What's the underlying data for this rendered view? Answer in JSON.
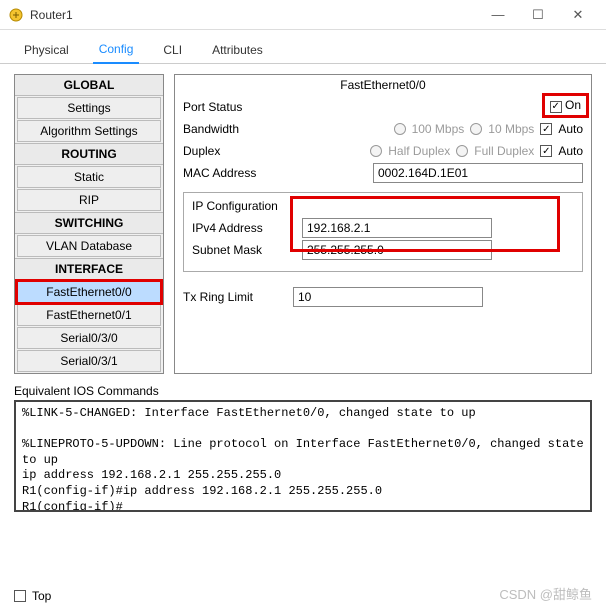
{
  "window": {
    "title": "Router1",
    "min": "—",
    "max": "☐",
    "close": "✕"
  },
  "tabs": {
    "physical": "Physical",
    "config": "Config",
    "cli": "CLI",
    "attributes": "Attributes"
  },
  "sidebar": {
    "global": "GLOBAL",
    "settings": "Settings",
    "algorithm": "Algorithm Settings",
    "routing": "ROUTING",
    "static": "Static",
    "rip": "RIP",
    "switching": "SWITCHING",
    "vlandb": "VLAN Database",
    "interface": "INTERFACE",
    "fe00": "FastEthernet0/0",
    "fe01": "FastEthernet0/1",
    "s030": "Serial0/3/0",
    "s031": "Serial0/3/1"
  },
  "panel": {
    "title": "FastEthernet0/0",
    "port_status": "Port Status",
    "on": "On",
    "bandwidth": "Bandwidth",
    "bw100": "100 Mbps",
    "bw10": "10 Mbps",
    "auto": "Auto",
    "duplex": "Duplex",
    "half": "Half Duplex",
    "full": "Full Duplex",
    "mac_label": "MAC Address",
    "mac_value": "0002.164D.1E01",
    "ipconfig": "IP Configuration",
    "ipv4_label": "IPv4 Address",
    "ipv4_value": "192.168.2.1",
    "subnet_label": "Subnet Mask",
    "subnet_value": "255.255.255.0",
    "tx_label": "Tx Ring Limit",
    "tx_value": "10"
  },
  "cmds": {
    "label": "Equivalent IOS Commands",
    "text": "%LINK-5-CHANGED: Interface FastEthernet0/0, changed state to up\n\n%LINEPROTO-5-UPDOWN: Line protocol on Interface FastEthernet0/0, changed state to up\nip address 192.168.2.1 255.255.255.0\nR1(config-if)#ip address 192.168.2.1 255.255.255.0\nR1(config-if)#"
  },
  "footer": {
    "top": "Top"
  },
  "watermark": "CSDN @甜鲸鱼"
}
